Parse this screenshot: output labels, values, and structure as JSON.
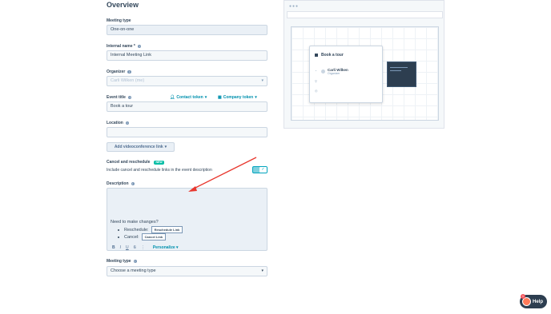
{
  "page": {
    "heading": "Overview"
  },
  "form": {
    "meeting_type_label": "Meeting type",
    "meeting_type_value": "One-on-one",
    "internal_name_label": "Internal name *",
    "internal_name_value": "Internal Meeting Link",
    "organizer_label": "Organizer",
    "organizer_value": "Carli Wilken (me)",
    "event_title_label": "Event title",
    "contact_token": "Contact token",
    "company_token": "Company token",
    "event_title_value": "Book a tour",
    "location_label": "Location",
    "location_value": "",
    "add_videoconference": "Add videoconference link",
    "cancel_label": "Cancel and reschedule",
    "new_badge": "NEW",
    "cancel_help": "Include cancel and reschedule links in the event description",
    "description_label": "Description",
    "description_line": "Need to make changes?",
    "reschedule_label": "Reschedule:",
    "reschedule_chip": "Reschedule Link",
    "cancel_row_label": "Cancel:",
    "cancel_chip": "Cancel Link",
    "personalize": "Personalize",
    "meeting_type_label_2": "Meeting type",
    "meeting_type_placeholder": "Choose a meeting type"
  },
  "preview": {
    "card_title": "Book a tour",
    "organizer_name": "Carli Wilken",
    "organizer_role": "Organizer"
  },
  "help": {
    "label": "Help",
    "badge": "1"
  },
  "colors": {
    "accent": "#0091ae",
    "toggle": "#00a4bd",
    "arrow": "#e8382f"
  }
}
